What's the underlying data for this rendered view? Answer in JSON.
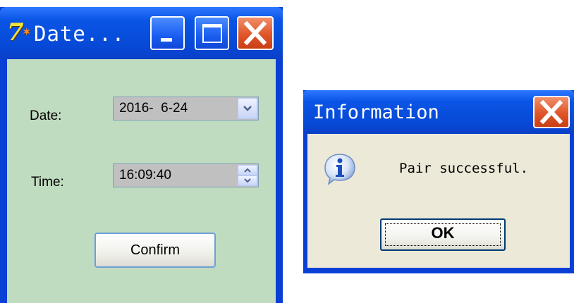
{
  "date_window": {
    "title": "Date...",
    "app_icon_glyph": "7",
    "date_label": "Date:",
    "date_value": "2016-  6-24",
    "time_label": "Time:",
    "time_value": "16:09:40",
    "confirm_label": "Confirm",
    "titlebar_color": "#0a55e6",
    "client_bg": "#c0dcc0"
  },
  "info_dialog": {
    "title": "Information",
    "message": "Pair successful.",
    "ok_label": "OK",
    "icon": "information-icon",
    "client_bg": "#ece9d8"
  }
}
